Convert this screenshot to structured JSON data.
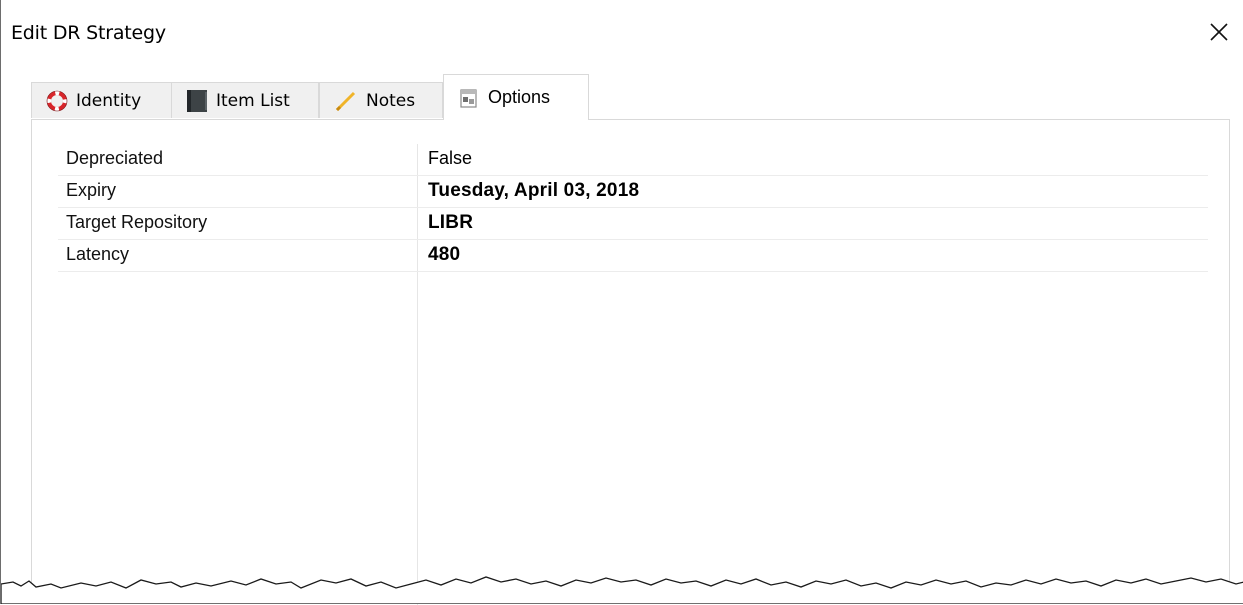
{
  "window": {
    "title": "Edit DR Strategy",
    "close_icon": "close-icon"
  },
  "tabs": [
    {
      "label": "Identity",
      "icon": "lifebuoy-icon",
      "active": false
    },
    {
      "label": "Item List",
      "icon": "list-book-icon",
      "active": false
    },
    {
      "label": "Notes",
      "icon": "pencil-icon",
      "active": false
    },
    {
      "label": "Options",
      "icon": "options-icon",
      "active": true
    }
  ],
  "properties": [
    {
      "name": "Depreciated",
      "value": "False",
      "bold": false
    },
    {
      "name": "Expiry",
      "value": "Tuesday, April 03, 2018",
      "bold": true
    },
    {
      "name": "Target Repository",
      "value": "LIBR",
      "bold": true
    },
    {
      "name": "Latency",
      "value": "480",
      "bold": true
    }
  ]
}
